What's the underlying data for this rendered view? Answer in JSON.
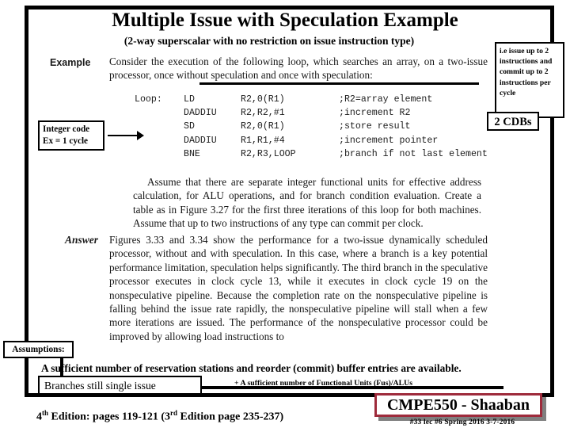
{
  "slide": {
    "title": "Multiple Issue with Speculation Example",
    "subtitle": "(2-way superscalar with no restriction on issue instruction type)"
  },
  "textbook": {
    "example_label": "Example",
    "answer_label": "Answer",
    "example_intro": "Consider the execution of the following loop, which searches an array, on a two-issue processor, once without speculation and once with speculation:",
    "code": {
      "loop_label": "Loop:",
      "lines": [
        {
          "label": "Loop:",
          "op": "LD",
          "args": "R2,0(R1)",
          "comment": ";R2=array element"
        },
        {
          "label": "",
          "op": "DADDIU",
          "args": "R2,R2,#1",
          "comment": ";increment R2"
        },
        {
          "label": "",
          "op": "SD",
          "args": "R2,0(R1)",
          "comment": ";store result"
        },
        {
          "label": "",
          "op": "DADDIU",
          "args": "R1,R1,#4",
          "comment": ";increment pointer"
        },
        {
          "label": "",
          "op": "BNE",
          "args": "R2,R3,LOOP",
          "comment": ";branch if not last element"
        }
      ]
    },
    "assume_para": "Assume that there are separate integer functional units for effective address calculation, for ALU operations, and for branch condition evaluation. Create a table as in Figure 3.27 for the first three iterations of this loop for both machines. Assume that up to two instructions of any type can commit per clock.",
    "answer_para": "Figures 3.33 and 3.34 show the performance for a two-issue dynamically scheduled processor, without and with speculation. In this case, where a branch is a key potential performance limitation, speculation helps significantly. The third branch in the speculative processor executes in clock cycle 13, while it executes in clock cycle 19 on the nonspeculative pipeline. Because the completion rate on the nonspeculative pipeline is falling behind the issue rate rapidly, the nonspeculative pipeline will stall when a few more iterations are issued. The performance of the nonspeculative processor could be improved by allowing load instructions to"
  },
  "annotations": {
    "issue_note": "i.e issue up to 2 instructions and commit up to 2 instructions per cycle",
    "cdb_note": "2 CDBs",
    "integer_code_note": "Integer code Ex = 1 cycle",
    "assumptions_label": "Assumptions:",
    "assumption_1": "A sufficient number of reservation stations and reorder (commit) buffer entries are available.",
    "assumption_2": "+ A sufficient number of Functional Units (Fus)/ALUs",
    "branches_note": "Branches still single issue"
  },
  "footer": {
    "edition_note_html": "4th Edition: pages 119-121  (3rd Edition page 235-237)",
    "edition_prefix": "4",
    "edition_sup1": "th",
    "edition_mid": " Edition: pages 119-121  (3",
    "edition_sup2": "rd",
    "edition_suffix": " Edition page 235-237)",
    "course_tag": "CMPE550 - Shaaban",
    "meta": "#33   lec #6  Spring 2016  3-7-2016"
  },
  "colors": {
    "accent_red": "#9e2b3c",
    "frame_black": "#000000",
    "shadow_gray": "#808080"
  }
}
